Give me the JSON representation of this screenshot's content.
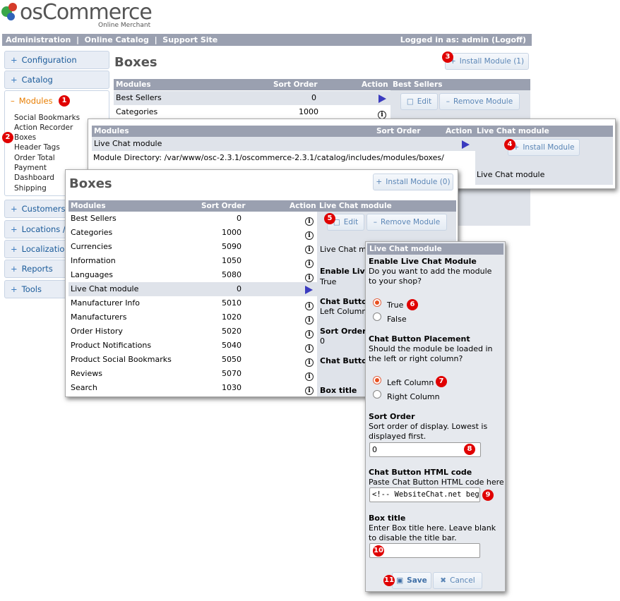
{
  "logo": {
    "name": "osCommerce",
    "tagline": "Online Merchant"
  },
  "topbar": {
    "links": [
      "Administration",
      "Online Catalog",
      "Support Site"
    ],
    "separator": "|",
    "logged_in": "Logged in as: admin (Logoff)"
  },
  "sidebar": {
    "items": [
      "Configuration",
      "Catalog",
      "Modules",
      "Customers",
      "Locations / Taxes",
      "Localization",
      "Reports",
      "Tools"
    ],
    "modules_sub": [
      "Social Bookmarks",
      "Action Recorder",
      "Boxes",
      "Header Tags",
      "Order Total",
      "Payment",
      "Dashboard",
      "Shipping"
    ]
  },
  "page": {
    "title": "Boxes",
    "install_btn": "Install Module (1)"
  },
  "main_table": {
    "headers": [
      "Modules",
      "Sort Order",
      "Action"
    ],
    "rows": [
      {
        "name": "Best Sellers",
        "order": "0"
      },
      {
        "name": "Categories",
        "order": "1000"
      }
    ],
    "right_header": "Best Sellers",
    "edit": "Edit",
    "remove": "Remove Module"
  },
  "popup1": {
    "headers": [
      "Modules",
      "Sort Order",
      "Action"
    ],
    "row": "Live Chat module",
    "directory": "Module Directory: /var/www/osc-2.3.1/oscommerce-2.3.1/catalog/includes/modules/boxes/",
    "right_header": "Live Chat module",
    "install": "Install Module",
    "right_text": "Live Chat module"
  },
  "popup2": {
    "title": "Boxes",
    "install_btn": "Install Module (0)",
    "headers": [
      "Modules",
      "Sort Order",
      "Action"
    ],
    "right_header": "Live Chat module",
    "edit": "Edit",
    "remove": "Remove Module",
    "rows": [
      {
        "name": "Best Sellers",
        "order": "0",
        "action": "info"
      },
      {
        "name": "Categories",
        "order": "1000",
        "action": "info"
      },
      {
        "name": "Currencies",
        "order": "5090",
        "action": "info"
      },
      {
        "name": "Information",
        "order": "1050",
        "action": "info"
      },
      {
        "name": "Languages",
        "order": "5080",
        "action": "info"
      },
      {
        "name": "Live Chat module",
        "order": "0",
        "action": "arrow"
      },
      {
        "name": "Manufacturer Info",
        "order": "5010",
        "action": "info"
      },
      {
        "name": "Manufacturers",
        "order": "1020",
        "action": "info"
      },
      {
        "name": "Order History",
        "order": "5020",
        "action": "info"
      },
      {
        "name": "Product Notifications",
        "order": "5040",
        "action": "info"
      },
      {
        "name": "Product Social Bookmarks",
        "order": "5050",
        "action": "info"
      },
      {
        "name": "Reviews",
        "order": "5070",
        "action": "info"
      },
      {
        "name": "Search",
        "order": "1030",
        "action": "info"
      }
    ],
    "side_info": [
      "Live Chat mo",
      "Enable Live",
      "True",
      "Chat Button",
      "Left Column",
      "Sort Order",
      "0",
      "Chat Button",
      "Box title"
    ]
  },
  "edit_form": {
    "header": "Live Chat module",
    "enable_title": "Enable Live Chat Module",
    "enable_desc": "Do you want to add the module to your shop?",
    "opt_true": "True",
    "opt_false": "False",
    "placement_title": "Chat Button Placement",
    "placement_desc": "Should the module be loaded in the left or right column?",
    "opt_left": "Left Column",
    "opt_right": "Right Column",
    "sort_title": "Sort Order",
    "sort_desc": "Sort order of display. Lowest is displayed first.",
    "sort_value": "0",
    "html_title": "Chat Button HTML code",
    "html_desc": "Paste Chat Button HTML code here",
    "html_value": "<!-- WebsiteChat.net begin",
    "box_title": "Box title",
    "box_desc": "Enter Box title here. Leave blank to disable the title bar.",
    "box_value": "",
    "save": "Save",
    "cancel": "Cancel"
  },
  "badges": [
    "1",
    "2",
    "3",
    "4",
    "5",
    "6",
    "7",
    "8",
    "9",
    "10",
    "11"
  ],
  "colors": {
    "header_bar": "#9aa0b0",
    "badge": "#e00000",
    "accent": "#e87d00",
    "link": "#1b5b9a"
  }
}
